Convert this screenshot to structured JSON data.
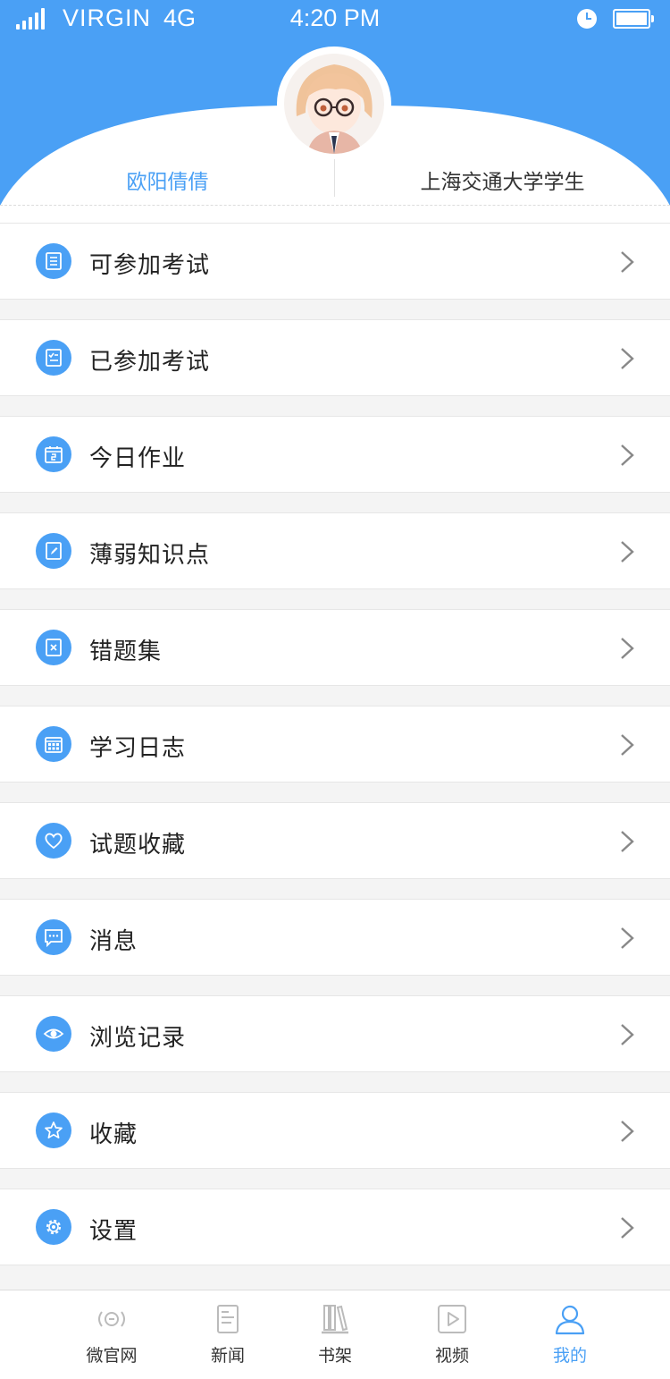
{
  "status_bar": {
    "carrier": "VIRGIN",
    "network": "4G",
    "time": "4:20 PM"
  },
  "profile": {
    "name": "欧阳倩倩",
    "school": "上海交通大学学生"
  },
  "menu": [
    {
      "label": "可参加考试",
      "icon": "exam-list-icon"
    },
    {
      "label": "已参加考试",
      "icon": "exam-done-icon"
    },
    {
      "label": "今日作业",
      "icon": "calendar-day-icon"
    },
    {
      "label": "薄弱知识点",
      "icon": "note-edit-icon"
    },
    {
      "label": "错题集",
      "icon": "wrong-book-icon"
    },
    {
      "label": "学习日志",
      "icon": "calendar-grid-icon"
    },
    {
      "label": "试题收藏",
      "icon": "heart-icon"
    },
    {
      "label": "消息",
      "icon": "chat-bubble-icon"
    },
    {
      "label": "浏览记录",
      "icon": "eye-icon"
    },
    {
      "label": "收藏",
      "icon": "star-icon"
    },
    {
      "label": "设置",
      "icon": "gear-icon"
    }
  ],
  "tabbar": {
    "tabs": [
      {
        "label": "微官网",
        "icon": "broadcast-icon",
        "active": false
      },
      {
        "label": "新闻",
        "icon": "document-icon",
        "active": false
      },
      {
        "label": "书架",
        "icon": "bookshelf-icon",
        "active": false
      },
      {
        "label": "视频",
        "icon": "play-icon",
        "active": false
      },
      {
        "label": "我的",
        "icon": "person-icon",
        "active": true
      }
    ]
  },
  "colors": {
    "accent": "#4aa0f5",
    "background": "#f4f4f4",
    "text": "#222222"
  }
}
